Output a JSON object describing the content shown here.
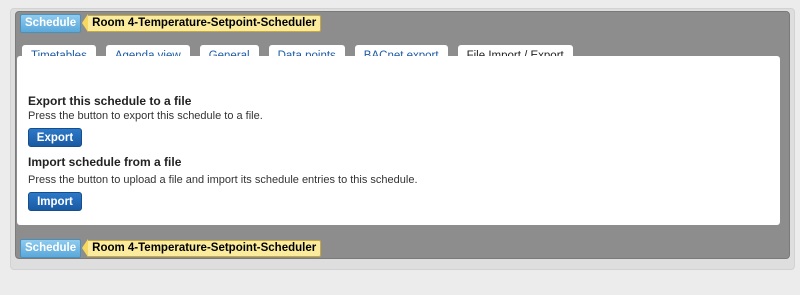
{
  "breadcrumb": {
    "root_label": "Schedule",
    "schedule_name": "Room 4-Temperature-Setpoint-Scheduler"
  },
  "tabs": [
    {
      "label": "Timetables"
    },
    {
      "label": "Agenda view"
    },
    {
      "label": "General"
    },
    {
      "label": "Data points"
    },
    {
      "label": "BACnet export"
    },
    {
      "label": "File Import / Export"
    }
  ],
  "active_tab": "File Import / Export",
  "export_section": {
    "title": "Export this schedule to a file",
    "description": "Press the button to export this schedule to a file.",
    "button_label": "Export"
  },
  "import_section": {
    "title": "Import schedule from a file",
    "description": "Press the button to upload a file and import its schedule entries to this schedule.",
    "button_label": "Import"
  },
  "colors": {
    "tab_underline": "#2e6ab3",
    "button": "#1f64b0",
    "crumb_schedule": "#6bb5e3",
    "crumb_name": "#fbec9d"
  }
}
